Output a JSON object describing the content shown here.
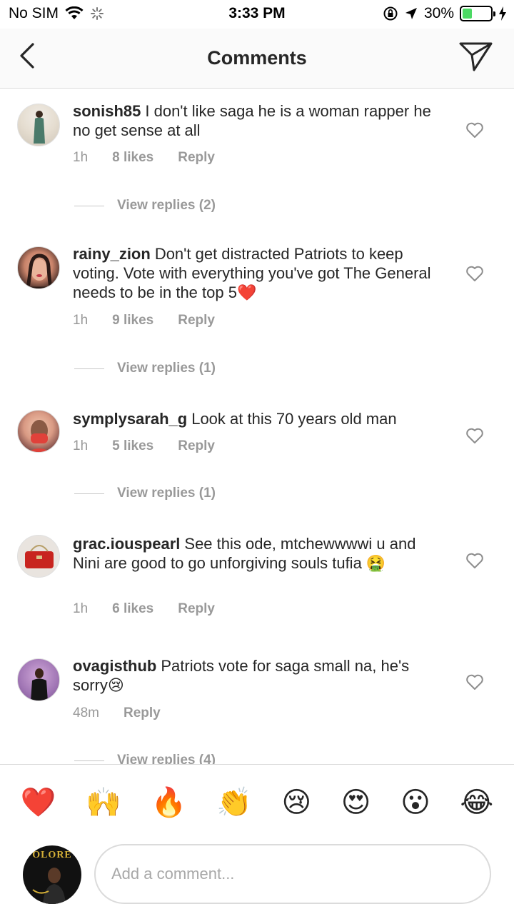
{
  "status_bar": {
    "carrier": "No SIM",
    "time": "3:33 PM",
    "battery_percent": "30%",
    "battery_level": 0.3,
    "battery_color": "#4cd964"
  },
  "header": {
    "title": "Comments",
    "back_icon": "chevron-left-icon",
    "send_icon": "paper-plane-icon"
  },
  "comments": [
    {
      "username": "sonish85",
      "text": "I don't like saga  he is a woman rapper he no get sense at all",
      "time": "1h",
      "likes": "8 likes",
      "reply": "Reply",
      "view_replies": "View replies (2)"
    },
    {
      "username": "rainy_zion",
      "text": "Don't get distracted Patriots to keep voting. Vote with everything you've got The General needs to be in the top 5❤️",
      "time": "1h",
      "likes": "9 likes",
      "reply": "Reply",
      "view_replies": "View replies (1)"
    },
    {
      "username": "symplysarah_g",
      "text": "Look at this 70 years old man",
      "time": "1h",
      "likes": "5 likes",
      "reply": "Reply",
      "view_replies": "View replies (1)"
    },
    {
      "username": "grac.iouspearl",
      "text": "See this ode, mtchewwwwi u and Nini are good to go unforgiving souls tufia 🤮",
      "time": "1h",
      "likes": "6 likes",
      "reply": "Reply",
      "view_replies": ""
    },
    {
      "username": "ovagisthub",
      "text": "Patriots vote for saga small na, he's sorry😢",
      "time": "48m",
      "likes": "",
      "reply": "Reply",
      "view_replies": "View replies (4)"
    }
  ],
  "emoji_bar": [
    "❤️",
    "🙌",
    "🔥",
    "👏",
    "😢",
    "😍",
    "😮",
    "😂"
  ],
  "composer": {
    "placeholder": "Add a comment...",
    "avatar_text": "OLORE"
  }
}
